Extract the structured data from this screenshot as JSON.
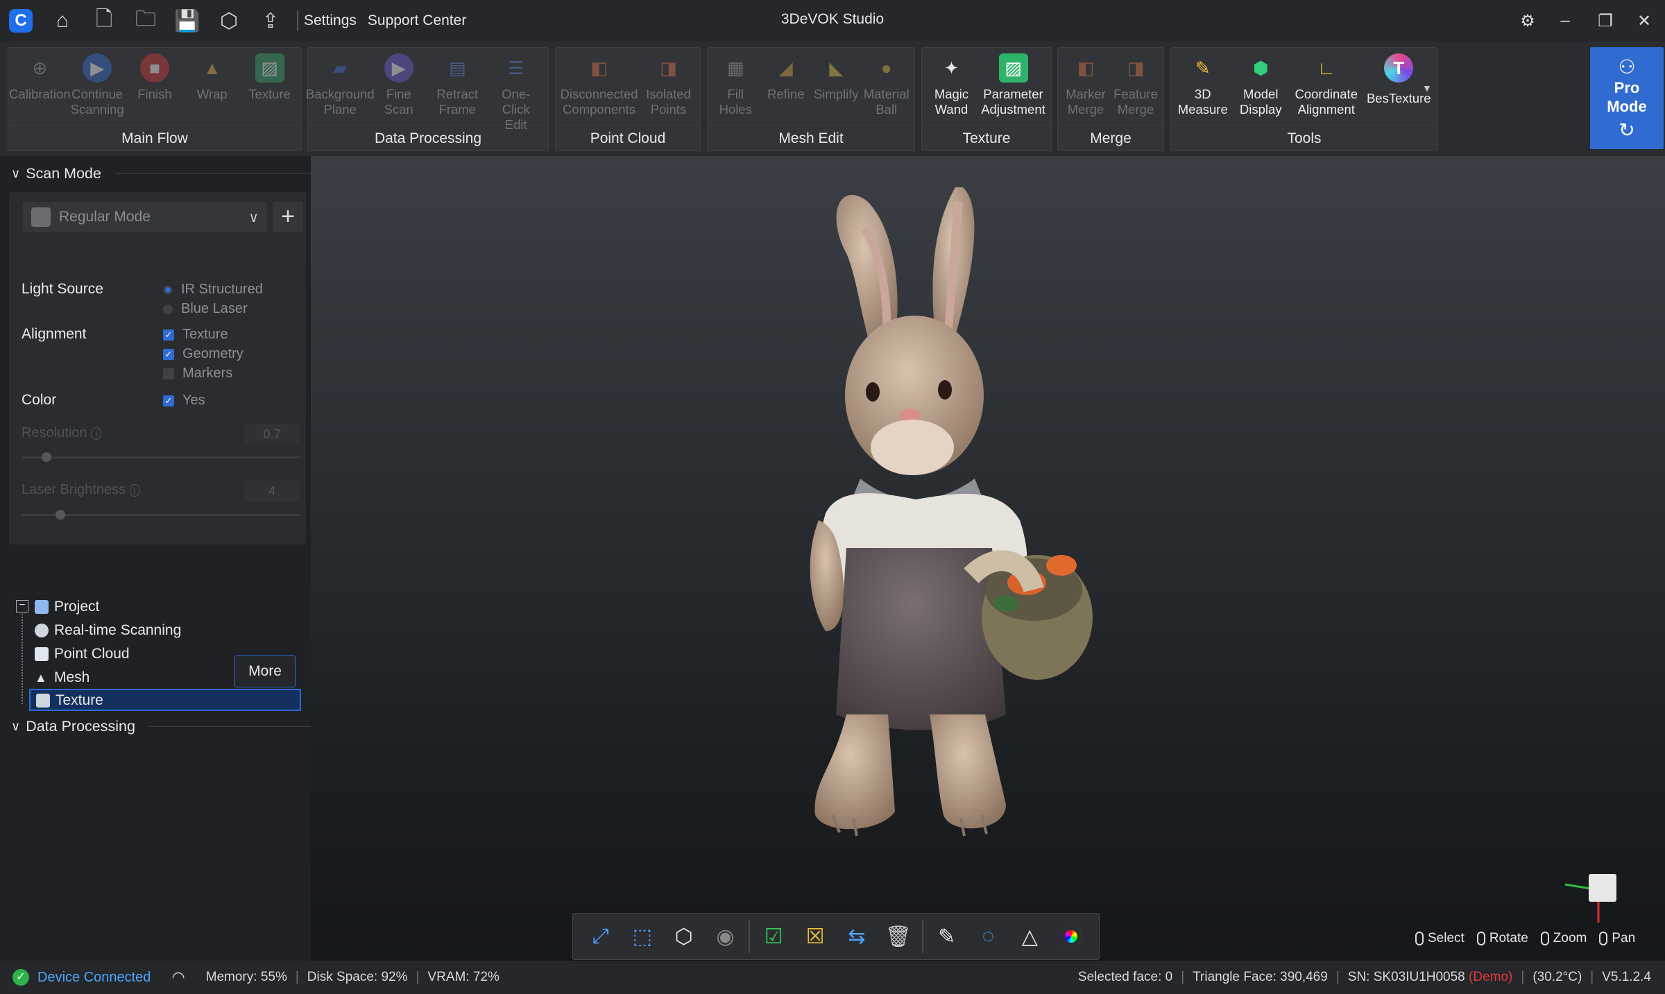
{
  "titlebar": {
    "app_title": "3DeVOK Studio",
    "menu": [
      "Settings",
      "Support Center"
    ],
    "icons": [
      "app-logo-icon",
      "home-icon",
      "new-project-icon",
      "open-project-icon",
      "save-icon",
      "export-model-icon",
      "upload-icon"
    ]
  },
  "ribbon": {
    "groups": [
      {
        "title": "Main Flow",
        "buttons": [
          {
            "label": "Calibration",
            "enabled": false
          },
          {
            "label": "Continue\nScanning",
            "enabled": false
          },
          {
            "label": "Finish",
            "enabled": false
          },
          {
            "label": "Wrap",
            "enabled": false
          },
          {
            "label": "Texture",
            "enabled": false
          }
        ]
      },
      {
        "title": "Data Processing",
        "buttons": [
          {
            "label": "Background\nPlane",
            "enabled": false
          },
          {
            "label": "Fine\nScan",
            "enabled": false
          },
          {
            "label": "Retract\nFrame",
            "enabled": false
          },
          {
            "label": "One-\nClick Edit",
            "enabled": false
          }
        ]
      },
      {
        "title": "Point Cloud",
        "buttons": [
          {
            "label": "Disconnected\nComponents",
            "enabled": false
          },
          {
            "label": "Isolated\nPoints",
            "enabled": false
          }
        ]
      },
      {
        "title": "Mesh Edit",
        "buttons": [
          {
            "label": "Fill\nHoles",
            "enabled": false
          },
          {
            "label": "Refine",
            "enabled": false
          },
          {
            "label": "Simplify",
            "enabled": false
          },
          {
            "label": "Material\nBall",
            "enabled": false
          }
        ]
      },
      {
        "title": "Texture",
        "buttons": [
          {
            "label": "Magic\nWand",
            "enabled": true
          },
          {
            "label": "Parameter\nAdjustment",
            "enabled": true
          }
        ]
      },
      {
        "title": "Merge",
        "buttons": [
          {
            "label": "Marker\nMerge",
            "enabled": false
          },
          {
            "label": "Feature\nMerge",
            "enabled": false
          }
        ]
      },
      {
        "title": "Tools",
        "buttons": [
          {
            "label": "3D\nMeasure",
            "enabled": true
          },
          {
            "label": "Model\nDisplay",
            "enabled": true
          },
          {
            "label": "Coordinate\nAlignment",
            "enabled": true
          },
          {
            "label": "BesTexture",
            "enabled": true
          }
        ]
      }
    ],
    "pro_mode": "Pro\nMode"
  },
  "scan_mode": {
    "header": "Scan Mode",
    "mode": "Regular Mode",
    "light_source_label": "Light Source",
    "light_source_options": [
      "IR Structured",
      "Blue Laser"
    ],
    "light_source_selected": "IR Structured",
    "alignment_label": "Alignment",
    "alignment_options": [
      {
        "label": "Texture",
        "checked": true
      },
      {
        "label": "Geometry",
        "checked": true
      },
      {
        "label": "Markers",
        "checked": false
      }
    ],
    "color_label": "Color",
    "color_option": {
      "label": "Yes",
      "checked": true
    },
    "resolution_label": "Resolution",
    "resolution_value": "0.7",
    "resolution_level": 0.09,
    "laser_brightness_label": "Laser Brightness",
    "laser_brightness_value": "4",
    "laser_brightness_level": 0.14,
    "more_button": "More"
  },
  "data_processing": {
    "header": "Data Processing",
    "tree": [
      {
        "label": "Project"
      },
      {
        "label": "Real-time Scanning"
      },
      {
        "label": "Point Cloud"
      },
      {
        "label": "Mesh"
      },
      {
        "label": "Texture",
        "selected": true
      }
    ]
  },
  "viewport": {
    "toolbar_icons": [
      "fit-view-icon",
      "front-view-icon",
      "iso-view-icon",
      "visibility-icon",
      "select-all-icon",
      "deselect-icon",
      "invert-selection-icon",
      "delete-icon",
      "brush-select-icon",
      "lasso-select-icon",
      "mesh-display-icon",
      "color-wheel-icon"
    ],
    "mouse_legend": [
      "Select",
      "Rotate",
      "Zoom",
      "Pan"
    ]
  },
  "status": {
    "device": "Device Connected",
    "memory_label": "Memory:",
    "memory": "55%",
    "disk_label": "Disk Space:",
    "disk": "92%",
    "vram_label": "VRAM:",
    "vram": "72%",
    "selected_face": "Selected face: 0",
    "triangle_face": "Triangle Face: 390,469",
    "sn": "SN: SK03IU1H0058",
    "demo": "(Demo)",
    "temperature": "(30.2°C)",
    "version": "V5.1.2.4"
  },
  "colors": {
    "accent": "#2f6bd1",
    "ok": "#2db34a",
    "demo": "#e03a3a",
    "link": "#4aa7ff"
  }
}
